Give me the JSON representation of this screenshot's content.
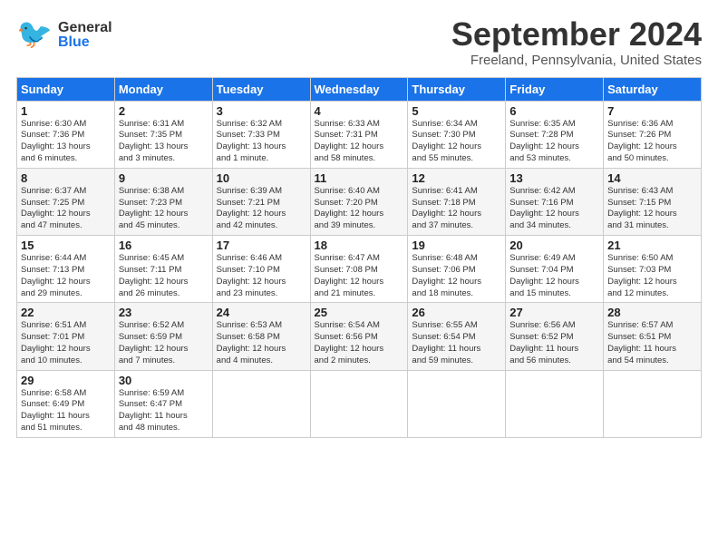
{
  "header": {
    "logo_general": "General",
    "logo_blue": "Blue",
    "month_title": "September 2024",
    "subtitle": "Freeland, Pennsylvania, United States"
  },
  "weekdays": [
    "Sunday",
    "Monday",
    "Tuesday",
    "Wednesday",
    "Thursday",
    "Friday",
    "Saturday"
  ],
  "weeks": [
    [
      {
        "day": "1",
        "info": "Sunrise: 6:30 AM\nSunset: 7:36 PM\nDaylight: 13 hours\nand 6 minutes."
      },
      {
        "day": "2",
        "info": "Sunrise: 6:31 AM\nSunset: 7:35 PM\nDaylight: 13 hours\nand 3 minutes."
      },
      {
        "day": "3",
        "info": "Sunrise: 6:32 AM\nSunset: 7:33 PM\nDaylight: 13 hours\nand 1 minute."
      },
      {
        "day": "4",
        "info": "Sunrise: 6:33 AM\nSunset: 7:31 PM\nDaylight: 12 hours\nand 58 minutes."
      },
      {
        "day": "5",
        "info": "Sunrise: 6:34 AM\nSunset: 7:30 PM\nDaylight: 12 hours\nand 55 minutes."
      },
      {
        "day": "6",
        "info": "Sunrise: 6:35 AM\nSunset: 7:28 PM\nDaylight: 12 hours\nand 53 minutes."
      },
      {
        "day": "7",
        "info": "Sunrise: 6:36 AM\nSunset: 7:26 PM\nDaylight: 12 hours\nand 50 minutes."
      }
    ],
    [
      {
        "day": "8",
        "info": "Sunrise: 6:37 AM\nSunset: 7:25 PM\nDaylight: 12 hours\nand 47 minutes."
      },
      {
        "day": "9",
        "info": "Sunrise: 6:38 AM\nSunset: 7:23 PM\nDaylight: 12 hours\nand 45 minutes."
      },
      {
        "day": "10",
        "info": "Sunrise: 6:39 AM\nSunset: 7:21 PM\nDaylight: 12 hours\nand 42 minutes."
      },
      {
        "day": "11",
        "info": "Sunrise: 6:40 AM\nSunset: 7:20 PM\nDaylight: 12 hours\nand 39 minutes."
      },
      {
        "day": "12",
        "info": "Sunrise: 6:41 AM\nSunset: 7:18 PM\nDaylight: 12 hours\nand 37 minutes."
      },
      {
        "day": "13",
        "info": "Sunrise: 6:42 AM\nSunset: 7:16 PM\nDaylight: 12 hours\nand 34 minutes."
      },
      {
        "day": "14",
        "info": "Sunrise: 6:43 AM\nSunset: 7:15 PM\nDaylight: 12 hours\nand 31 minutes."
      }
    ],
    [
      {
        "day": "15",
        "info": "Sunrise: 6:44 AM\nSunset: 7:13 PM\nDaylight: 12 hours\nand 29 minutes."
      },
      {
        "day": "16",
        "info": "Sunrise: 6:45 AM\nSunset: 7:11 PM\nDaylight: 12 hours\nand 26 minutes."
      },
      {
        "day": "17",
        "info": "Sunrise: 6:46 AM\nSunset: 7:10 PM\nDaylight: 12 hours\nand 23 minutes."
      },
      {
        "day": "18",
        "info": "Sunrise: 6:47 AM\nSunset: 7:08 PM\nDaylight: 12 hours\nand 21 minutes."
      },
      {
        "day": "19",
        "info": "Sunrise: 6:48 AM\nSunset: 7:06 PM\nDaylight: 12 hours\nand 18 minutes."
      },
      {
        "day": "20",
        "info": "Sunrise: 6:49 AM\nSunset: 7:04 PM\nDaylight: 12 hours\nand 15 minutes."
      },
      {
        "day": "21",
        "info": "Sunrise: 6:50 AM\nSunset: 7:03 PM\nDaylight: 12 hours\nand 12 minutes."
      }
    ],
    [
      {
        "day": "22",
        "info": "Sunrise: 6:51 AM\nSunset: 7:01 PM\nDaylight: 12 hours\nand 10 minutes."
      },
      {
        "day": "23",
        "info": "Sunrise: 6:52 AM\nSunset: 6:59 PM\nDaylight: 12 hours\nand 7 minutes."
      },
      {
        "day": "24",
        "info": "Sunrise: 6:53 AM\nSunset: 6:58 PM\nDaylight: 12 hours\nand 4 minutes."
      },
      {
        "day": "25",
        "info": "Sunrise: 6:54 AM\nSunset: 6:56 PM\nDaylight: 12 hours\nand 2 minutes."
      },
      {
        "day": "26",
        "info": "Sunrise: 6:55 AM\nSunset: 6:54 PM\nDaylight: 11 hours\nand 59 minutes."
      },
      {
        "day": "27",
        "info": "Sunrise: 6:56 AM\nSunset: 6:52 PM\nDaylight: 11 hours\nand 56 minutes."
      },
      {
        "day": "28",
        "info": "Sunrise: 6:57 AM\nSunset: 6:51 PM\nDaylight: 11 hours\nand 54 minutes."
      }
    ],
    [
      {
        "day": "29",
        "info": "Sunrise: 6:58 AM\nSunset: 6:49 PM\nDaylight: 11 hours\nand 51 minutes."
      },
      {
        "day": "30",
        "info": "Sunrise: 6:59 AM\nSunset: 6:47 PM\nDaylight: 11 hours\nand 48 minutes."
      },
      {
        "day": "",
        "info": ""
      },
      {
        "day": "",
        "info": ""
      },
      {
        "day": "",
        "info": ""
      },
      {
        "day": "",
        "info": ""
      },
      {
        "day": "",
        "info": ""
      }
    ]
  ]
}
